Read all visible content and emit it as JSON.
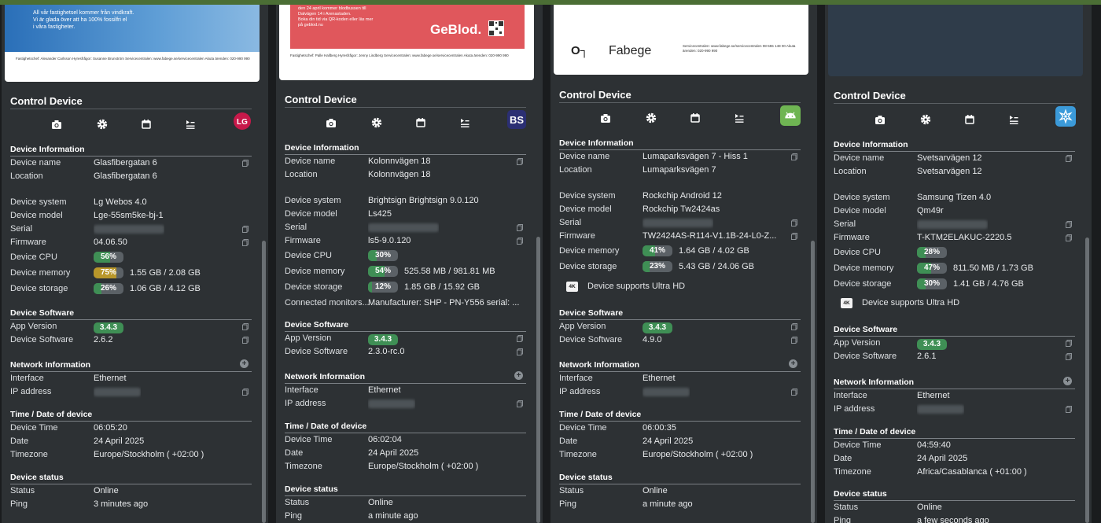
{
  "panels": [
    {
      "preview_lines": [
        "All vår fastighetsel kommer från vindkraft.",
        "Vi är glada över att ha 100% fossilfri el",
        "i våra fastigheter."
      ],
      "preview_footer": "Fastighetschef: Alexander Carlsson   Hyresfrågor: Susanne Brunström   Servicecentralen: www.fabege.se/servicecentralen   Akuta ärenden: 020-990 990",
      "control_title": "Control Device",
      "brand_icon": "lg-logo-icon",
      "brand_text": "LG",
      "info_title": "Device Information",
      "name_label": "Device name",
      "name_value": "Glasfibergatan 6",
      "location_label": "Location",
      "location_value": "Glasfibergatan 6",
      "system_label": "Device system",
      "system_value": "Lg Webos 4.0",
      "model_label": "Device model",
      "model_value": "Lge-55sm5ke-bj-1",
      "serial_label": "Serial",
      "firmware_label": "Firmware",
      "firmware_value": "04.06.50",
      "cpu_label": "Device CPU",
      "cpu_value": "56%",
      "cpu_pct": 56,
      "cpu_color": "#3f8f55",
      "memory_label": "Device memory",
      "memory_value": "75%",
      "memory_pct": 75,
      "memory_color": "#b9972a",
      "memory_text": "1.55 GB / 2.08 GB",
      "storage_label": "Device storage",
      "storage_value": "26%",
      "storage_pct": 26,
      "storage_color": "#3f8f55",
      "storage_text": "1.06 GB / 4.12 GB",
      "software_title": "Device Software",
      "app_label": "App Version",
      "app_value": "3.4.3",
      "sw_label": "Device Software",
      "sw_value": "2.6.2",
      "network_title": "Network Information",
      "interface_label": "Interface",
      "interface_value": "Ethernet",
      "ip_label": "IP address",
      "time_title": "Time / Date of device",
      "time_label": "Device Time",
      "time_value": "06:05:20",
      "date_label": "Date",
      "date_value": "24 April 2025",
      "tz_label": "Timezone",
      "tz_value": "Europe/Stockholm ( +02:00 )",
      "status_title": "Device status",
      "status_label": "Status",
      "status_value": "Online",
      "ping_label": "Ping",
      "ping_value": "3 minutes ago"
    },
    {
      "preview_lines": [
        "den 24 april kommer blodbussen till",
        "Dalvägen 14 i Arenastaden.",
        "Boka din tid via QR-koden eller läs mer",
        "på geblod.nu"
      ],
      "preview_brand": "GeBlod.",
      "preview_footer": "Fastighetschef: Palle Hallberg   Hyresfrågor: Jenny Lindberg   Servicecentralen: www.fabege.se/servicecentralen   Akuta ärenden: 020-990 990",
      "control_title": "Control Device",
      "brand_icon": "brightsign-logo-icon",
      "brand_text": "BS",
      "info_title": "Device Information",
      "name_label": "Device name",
      "name_value": "Kolonnvägen 18",
      "location_label": "Location",
      "location_value": "Kolonnvägen 18",
      "system_label": "Device system",
      "system_value": "Brightsign Brightsign 9.0.120",
      "model_label": "Device model",
      "model_value": "Ls425",
      "serial_label": "Serial",
      "firmware_label": "Firmware",
      "firmware_value": "ls5-9.0.120",
      "cpu_label": "Device CPU",
      "cpu_value": "30%",
      "cpu_pct": 30,
      "cpu_color": "#3f8f55",
      "memory_label": "Device memory",
      "memory_value": "54%",
      "memory_pct": 54,
      "memory_color": "#3f8f55",
      "memory_text": "525.58 MB / 981.81 MB",
      "storage_label": "Device storage",
      "storage_value": "12%",
      "storage_pct": 12,
      "storage_color": "#3f8f55",
      "storage_text": "1.85 GB / 15.92 GB",
      "monitors_label": "Connected monitors...",
      "monitors_value": "Manufacturer: SHP - PN-Y556  serial: ...",
      "software_title": "Device Software",
      "app_label": "App Version",
      "app_value": "3.4.3",
      "sw_label": "Device Software",
      "sw_value": "2.3.0-rc.0",
      "network_title": "Network Information",
      "interface_label": "Interface",
      "interface_value": "Ethernet",
      "ip_label": "IP address",
      "time_title": "Time / Date of device",
      "time_label": "Device Time",
      "time_value": "06:02:04",
      "date_label": "Date",
      "date_value": "24 April 2025",
      "tz_label": "Timezone",
      "tz_value": "Europe/Stockholm ( +02:00 )",
      "status_title": "Device status",
      "status_label": "Status",
      "status_value": "Online",
      "ping_label": "Ping",
      "ping_value": "a minute ago"
    },
    {
      "preview_brand": "Fabege",
      "preview_footer": "Servicecentralen: www.fabege.se/servicecentralen 08-555 148 00   Akuta ärenden: 020-990 990",
      "control_title": "Control Device",
      "brand_icon": "android-logo-icon",
      "info_title": "Device Information",
      "name_label": "Device name",
      "name_value": "Lumaparksvägen 7 - Hiss 1",
      "location_label": "Location",
      "location_value": "Lumaparksvägen 7",
      "system_label": "Device system",
      "system_value": "Rockchip Android 12",
      "model_label": "Device model",
      "model_value": "Rockchip Tw2424as",
      "serial_label": "Serial",
      "firmware_label": "Firmware",
      "firmware_value": "TW2424AS-R114-V1.1B-24-L0-Z...",
      "memory_label": "Device memory",
      "memory_value": "41%",
      "memory_pct": 41,
      "memory_color": "#3f8f55",
      "memory_text": "1.64 GB / 4.02 GB",
      "storage_label": "Device storage",
      "storage_value": "23%",
      "storage_pct": 23,
      "storage_color": "#3f8f55",
      "storage_text": "5.43 GB / 24.06 GB",
      "uhd_badge": "4K",
      "uhd_text": "Device supports Ultra HD",
      "software_title": "Device Software",
      "app_label": "App Version",
      "app_value": "3.4.3",
      "sw_label": "Device Software",
      "sw_value": "4.9.0",
      "network_title": "Network Information",
      "interface_label": "Interface",
      "interface_value": "Ethernet",
      "ip_label": "IP address",
      "time_title": "Time / Date of device",
      "time_label": "Device Time",
      "time_value": "06:00:35",
      "date_label": "Date",
      "date_value": "24 April 2025",
      "tz_label": "Timezone",
      "tz_value": "Europe/Stockholm ( +02:00 )",
      "status_title": "Device status",
      "status_label": "Status",
      "status_value": "Online",
      "ping_label": "Ping",
      "ping_value": "a minute ago"
    },
    {
      "control_title": "Control Device",
      "brand_icon": "tizen-logo-icon",
      "info_title": "Device Information",
      "name_label": "Device name",
      "name_value": "Svetsarvägen 12",
      "location_label": "Location",
      "location_value": "Svetsarvägen 12",
      "system_label": "Device system",
      "system_value": "Samsung Tizen 4.0",
      "model_label": "Device model",
      "model_value": "Qm49r",
      "serial_label": "Serial",
      "firmware_label": "Firmware",
      "firmware_value": "T-KTM2ELAKUC-2220.5",
      "cpu_label": "Device CPU",
      "cpu_value": "28%",
      "cpu_pct": 28,
      "cpu_color": "#3f8f55",
      "memory_label": "Device memory",
      "memory_value": "47%",
      "memory_pct": 47,
      "memory_color": "#3f8f55",
      "memory_text": "811.50 MB / 1.73 GB",
      "storage_label": "Device storage",
      "storage_value": "30%",
      "storage_pct": 30,
      "storage_color": "#3f8f55",
      "storage_text": "1.41 GB / 4.76 GB",
      "uhd_badge": "4K",
      "uhd_text": "Device supports Ultra HD",
      "software_title": "Device Software",
      "app_label": "App Version",
      "app_value": "3.4.3",
      "sw_label": "Device Software",
      "sw_value": "2.6.1",
      "network_title": "Network Information",
      "interface_label": "Interface",
      "interface_value": "Ethernet",
      "ip_label": "IP address",
      "time_title": "Time / Date of device",
      "time_label": "Device Time",
      "time_value": "04:59:40",
      "date_label": "Date",
      "date_value": "24 April 2025",
      "tz_label": "Timezone",
      "tz_value": "Africa/Casablanca ( +01:00 )",
      "status_title": "Device status",
      "status_label": "Status",
      "status_value": "Online",
      "ping_label": "Ping",
      "ping_value": "a few seconds ago"
    }
  ],
  "colors": {
    "panel_bg": "#2d3134",
    "page_bg": "#1a1c1e",
    "accent_green": "#3f8f55",
    "warn_yellow": "#b9972a",
    "top_bar": "#4b6e35"
  },
  "control_icons": [
    "camera-icon",
    "gear-icon",
    "calendar-icon",
    "playlist-icon"
  ]
}
